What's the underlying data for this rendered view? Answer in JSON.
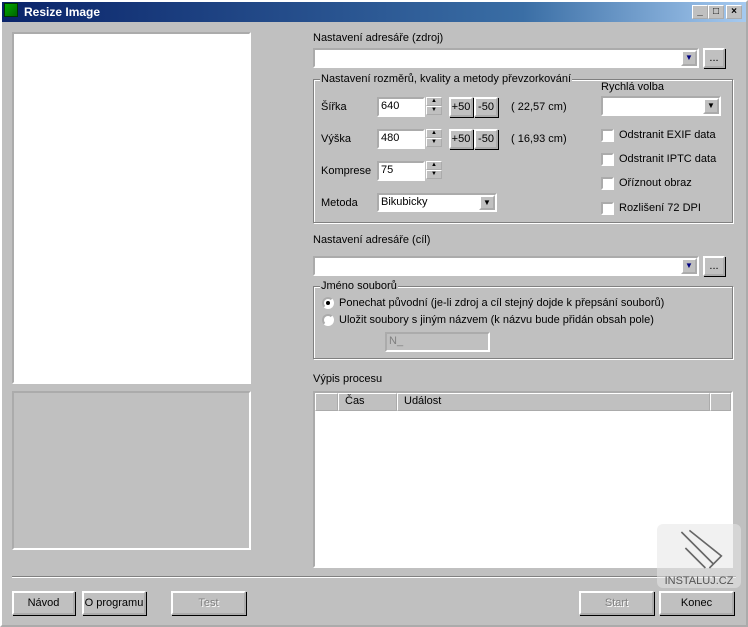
{
  "window": {
    "title": "Resize Image",
    "minimize": "_",
    "maximize": "□",
    "close": "×"
  },
  "source": {
    "label": "Nastavení adresáře (zdroj)",
    "value": "",
    "browse": "..."
  },
  "settings": {
    "legend": "Nastavení rozměrů, kvality a metody převzorkování",
    "width": {
      "label": "Šířka",
      "value": "640",
      "plus": "+50",
      "minus": "-50",
      "cm": "( 22,57 cm)"
    },
    "height": {
      "label": "Výška",
      "value": "480",
      "plus": "+50",
      "minus": "-50",
      "cm": "( 16,93 cm)"
    },
    "compression": {
      "label": "Komprese",
      "value": "75"
    },
    "method": {
      "label": "Metoda",
      "value": "Bikubicky"
    },
    "quick": {
      "label": "Rychlá volba",
      "value": ""
    },
    "checkboxes": [
      {
        "label": "Odstranit EXIF data",
        "checked": false
      },
      {
        "label": "Odstranit IPTC data",
        "checked": false
      },
      {
        "label": "Oříznout obraz",
        "checked": false
      },
      {
        "label": "Rozlišení 72 DPI",
        "checked": false
      }
    ]
  },
  "target": {
    "label": "Nastavení adresáře (cíl)",
    "value": "",
    "browse": "..."
  },
  "filename": {
    "legend": "Jméno souborů",
    "options": [
      {
        "label": "Ponechat původní (je-li zdroj a cíl stejný dojde k přepsání souborů)",
        "selected": true
      },
      {
        "label": "Uložit soubory s jiným názvem (k názvu bude přidán obsah pole)",
        "selected": false
      }
    ],
    "suffix": "N_"
  },
  "log": {
    "label": "Výpis procesu",
    "columns": [
      "",
      "Čas",
      "Událost",
      ""
    ],
    "rows": []
  },
  "buttons": {
    "help": "Návod",
    "about": "O programu",
    "test": "Test",
    "start": "Start",
    "end": "Konec"
  },
  "watermark": "INSTALUJ.CZ"
}
